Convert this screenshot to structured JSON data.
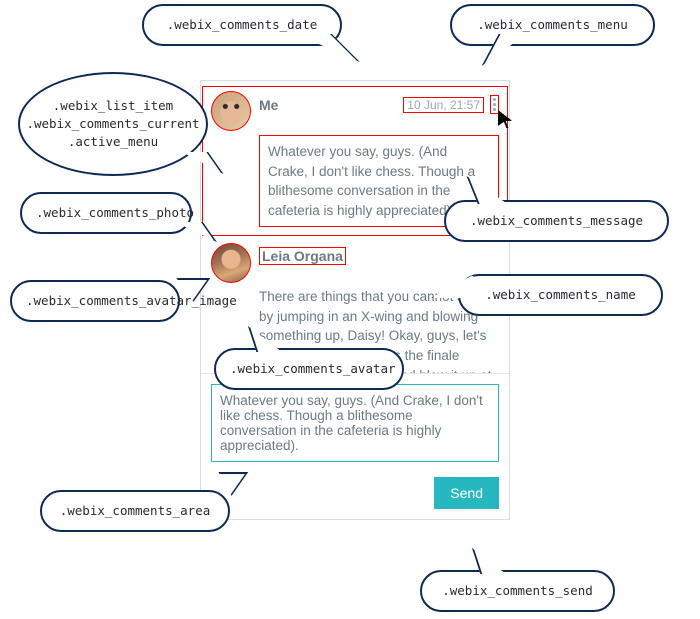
{
  "callouts": {
    "date": ".webix_comments_date",
    "menu": ".webix_comments_menu",
    "listitem": ".webix_list_item\n.webix_comments_current\n.active_menu",
    "photo": ".webix_comments_photo",
    "avatar_image": ".webix_comments_avatar_image",
    "message": ".webix_comments_message",
    "name": ".webix_comments_name",
    "avatar": ".webix_comments_avatar",
    "area": ".webix_comments_area",
    "send": ".webix_comments_send"
  },
  "comments": [
    {
      "name": "Me",
      "date": "10 Jun, 21:57",
      "message": "Whatever you say, guys. (And Crake, I don't like chess. Though a blithesome conversation in the cafeteria is highly appreciated)."
    },
    {
      "name": "Leia Organa",
      "date": "",
      "message": "There are things that you cannot solve by jumping in an X-wing and blowing something up, Daisy! Okay, guys, let's meet in person, discuss the finale details of the Webinar and blow it up at last."
    }
  ],
  "form": {
    "textarea_value": "Whatever you say, guys. (And Crake, I don't like chess. Though a blithesome conversation in the cafeteria is highly appreciated).",
    "send_label": "Send"
  }
}
